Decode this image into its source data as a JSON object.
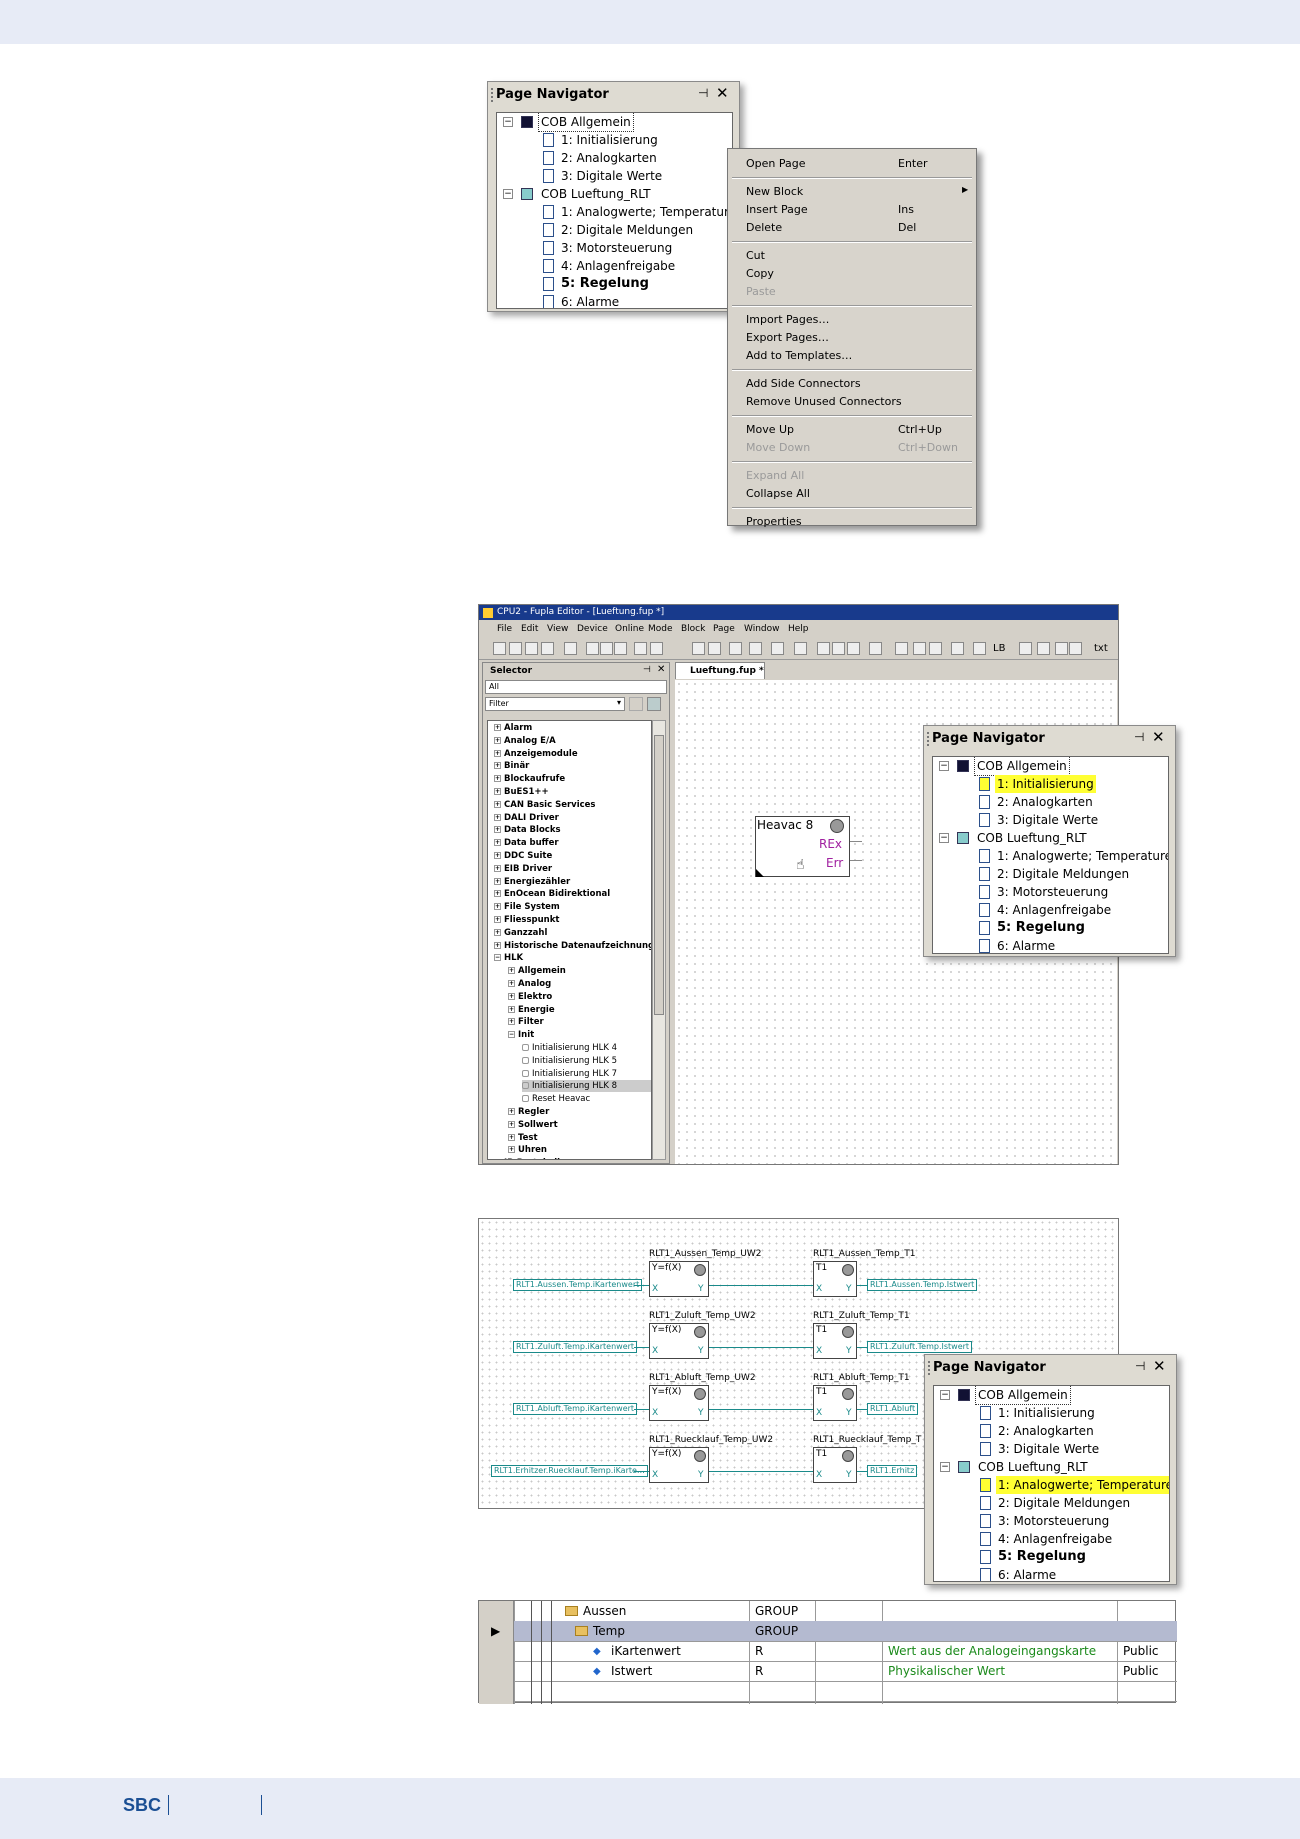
{
  "navigator": {
    "title": "Page Navigator",
    "pin_icon": "pin-icon",
    "close_icon": "close-icon",
    "groups": [
      {
        "label": "COB Allgemein",
        "pages": [
          "1: Initialisierung",
          "2: Analogkarten",
          "3: Digitale Werte"
        ]
      },
      {
        "label": "COB Lueftung_RLT",
        "pages": [
          "1: Analogwerte; Temperaturen",
          "2: Digitale Meldungen",
          "3: Motorsteuerung",
          "4: Anlagenfreigabe",
          "5: Regelung",
          "6: Alarme"
        ]
      }
    ]
  },
  "context_menu": {
    "items": [
      {
        "label": "Open Page",
        "shortcut": "Enter"
      },
      {
        "label": "New Block",
        "shortcut": ""
      },
      {
        "label": "Insert Page",
        "shortcut": "Ins"
      },
      {
        "label": "Delete",
        "shortcut": "Del"
      },
      {
        "label": "Cut",
        "shortcut": ""
      },
      {
        "label": "Copy",
        "shortcut": ""
      },
      {
        "label": "Paste",
        "shortcut": ""
      },
      {
        "label": "Import Pages…",
        "shortcut": ""
      },
      {
        "label": "Export Pages…",
        "shortcut": ""
      },
      {
        "label": "Add to Templates…",
        "shortcut": ""
      },
      {
        "label": "Add Side Connectors",
        "shortcut": ""
      },
      {
        "label": "Remove Unused Connectors",
        "shortcut": ""
      },
      {
        "label": "Move Up",
        "shortcut": "Ctrl+Up"
      },
      {
        "label": "Move Down",
        "shortcut": "Ctrl+Down"
      },
      {
        "label": "Expand All",
        "shortcut": ""
      },
      {
        "label": "Collapse All",
        "shortcut": ""
      },
      {
        "label": "Properties",
        "shortcut": ""
      }
    ]
  },
  "editor": {
    "title": "CPU2 -       Fupla Editor - [Lueftung.fup *]",
    "menu": [
      "File",
      "Edit",
      "View",
      "Device",
      "Online",
      "Mode",
      "Block",
      "Page",
      "Window",
      "Help"
    ],
    "toolbar_text": [
      "LB",
      "txt"
    ],
    "selector_title": "Selector",
    "selector_scope": "All",
    "filter_label": "Filter",
    "tab": "Lueftung.fup *",
    "selector_items": [
      "Alarm",
      "Analog E/A",
      "Anzeigemodule",
      "Binär",
      "Blockaufrufe",
      "BuES1++",
      "CAN Basic Services",
      "DALI Driver",
      "Data Blocks",
      "Data buffer",
      "DDC Suite",
      "EIB Driver",
      "Energiezähler",
      "EnOcean Bidirektional",
      "File System",
      "Fliesspunkt",
      "Ganzzahl",
      "Historische Datenaufzeichnung",
      "HLK"
    ],
    "hlk_children": [
      "Allgemein",
      "Analog",
      "Elektro",
      "Energie",
      "Filter",
      "Init"
    ],
    "init_children": [
      "Initialisierung HLK 4",
      "Initialisierung HLK 5",
      "Initialisierung HLK 7",
      "Initialisierung HLK 8",
      "Reset Heavac"
    ],
    "hlk_tail": [
      "Regler",
      "Sollwert",
      "Test",
      "Uhren"
    ],
    "selector_tail": "IP-Protokolle",
    "fbox": {
      "title": "Heavac 8",
      "out1": "REx",
      "out2": "Err"
    }
  },
  "fupla_rows": [
    {
      "left_tag": "RLT1.Aussen.Temp.iKartenwert",
      "block1": "RLT1_Aussen_Temp_UW2",
      "block2": "RLT1_Aussen_Temp_T1",
      "right_tag": "RLT1.Aussen.Temp.Istwert"
    },
    {
      "left_tag": "RLT1.Zuluft.Temp.iKartenwert",
      "block1": "RLT1_Zuluft_Temp_UW2",
      "block2": "RLT1_Zuluft_Temp_T1",
      "right_tag": "RLT1.Zuluft.Temp.Istwert"
    },
    {
      "left_tag": "RLT1.Abluft.Temp.iKartenwert",
      "block1": "RLT1_Abluft_Temp_UW2",
      "block2": "RLT1_Abluft_Temp_T1",
      "right_tag": "RLT1.Abluft"
    },
    {
      "left_tag": "RLT1.Erhitzer.Ruecklauf.Temp.iKarte…",
      "block1": "RLT1_Ruecklauf_Temp_UW2",
      "block2": "RLT1_Ruecklauf_Temp_T",
      "right_tag": "RLT1.Erhitz"
    }
  ],
  "fbox_labels": {
    "func": "Y=f(X)",
    "t1": "T1",
    "x": "X",
    "y": "Y"
  },
  "symbol_table": {
    "rows": [
      {
        "name": "Aussen",
        "type": "GROUP",
        "comment": "",
        "scope": ""
      },
      {
        "name": "Temp",
        "type": "GROUP",
        "comment": "",
        "scope": ""
      },
      {
        "name": "iKartenwert",
        "type": "R",
        "comment": "Wert aus der Analogeingangskarte",
        "scope": "Public"
      },
      {
        "name": "Istwert",
        "type": "R",
        "comment": "Physikalischer Wert",
        "scope": "Public"
      }
    ]
  },
  "footer": {
    "logo": "SBC"
  },
  "colors": {
    "band": "#e7ebf6",
    "highlight": "#ffff33",
    "teal": "#1a8a8a",
    "magenta": "#a020a0",
    "green": "#1b8a1b"
  }
}
